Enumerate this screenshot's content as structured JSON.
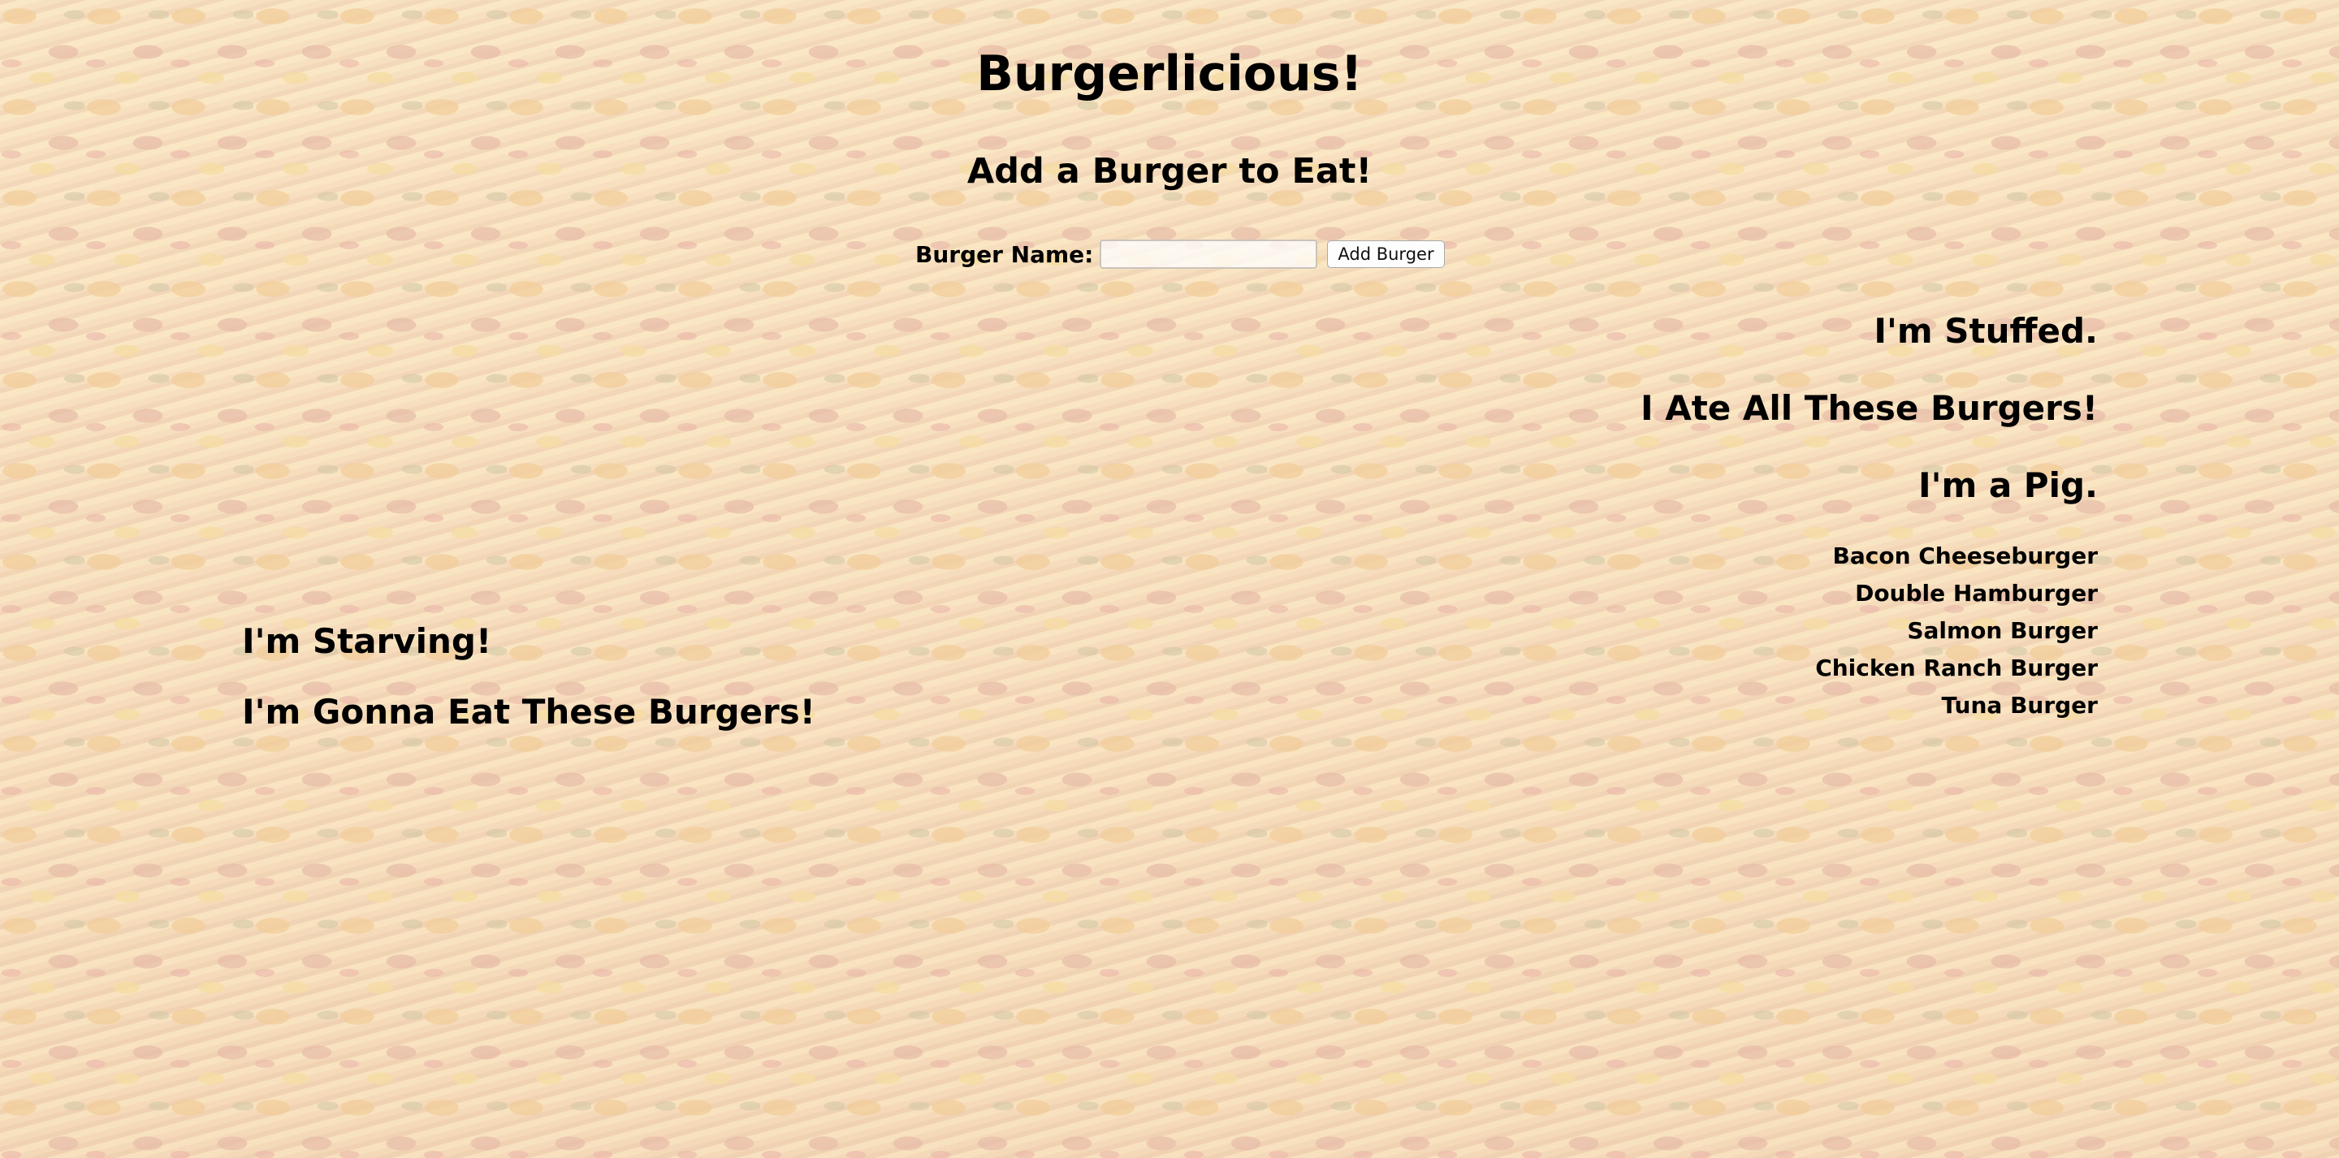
{
  "header": {
    "title": "Burgerlicious!",
    "subtitle": "Add a Burger to Eat!"
  },
  "form": {
    "label": "Burger Name:",
    "input_value": "",
    "input_placeholder": "",
    "button_label": "Add Burger"
  },
  "uneaten": {
    "heading_1": "I'm Starving!",
    "heading_2": "I'm Gonna Eat These Burgers!"
  },
  "eaten": {
    "heading_1": "I'm Stuffed.",
    "heading_2": "I Ate All These Burgers!",
    "heading_3": "I'm a Pig.",
    "items": [
      "Bacon Cheeseburger",
      "Double Hamburger",
      "Salmon Burger",
      "Chicken Ranch Burger",
      "Tuna Burger"
    ]
  },
  "colors": {
    "background": "#f3d9a8",
    "text": "#000000"
  }
}
